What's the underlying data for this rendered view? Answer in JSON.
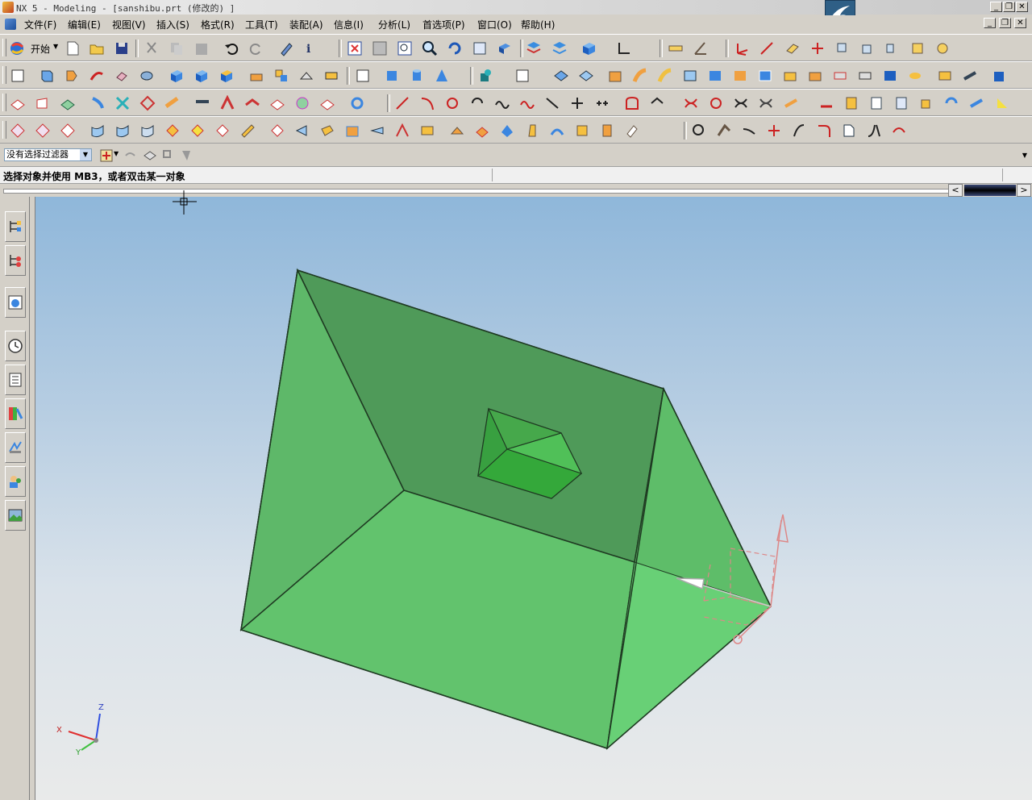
{
  "window": {
    "title": "NX 5 - Modeling - [sanshibu.prt (修改的) ]",
    "buttons": [
      "_",
      "❐",
      "✕"
    ]
  },
  "menubar": {
    "items": [
      "文件(F)",
      "编辑(E)",
      "视图(V)",
      "插入(S)",
      "格式(R)",
      "工具(T)",
      "装配(A)",
      "信息(I)",
      "分析(L)",
      "首选项(P)",
      "窗口(O)",
      "帮助(H)"
    ],
    "doc_buttons": [
      "_",
      "❐",
      "✕"
    ]
  },
  "toolbar": {
    "start_label": "开始"
  },
  "selection": {
    "filter_value": "没有选择过滤器"
  },
  "cue_line": {
    "text": "选择对象并使用 MB3，或者双击某一对象"
  },
  "triad": {
    "x_label": "X",
    "y_label": "Y",
    "z_label": "Z"
  },
  "colors": {
    "solid_face": "#5cc06a",
    "solid_edge": "#1f3a22",
    "background_top": "#8fb7da",
    "background_bottom": "#e9eaea"
  }
}
